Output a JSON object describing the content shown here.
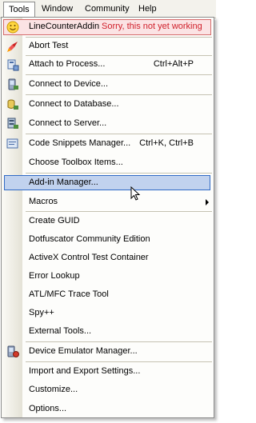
{
  "menubar": {
    "items": [
      "Tools",
      "Window",
      "Community",
      "Help"
    ]
  },
  "menu": {
    "error_item": {
      "label": "LineCounterAddin",
      "message": "Sorry, this not yet working",
      "icon": "smiley-icon"
    },
    "abort_test": {
      "label": "Abort Test",
      "icon": "rocket-icon"
    },
    "attach": {
      "label": "Attach to Process...",
      "shortcut": "Ctrl+Alt+P",
      "icon": "attach-process-icon"
    },
    "connect_device": {
      "label": "Connect to Device...",
      "icon": "device-icon"
    },
    "connect_db": {
      "label": "Connect to Database...",
      "icon": "database-icon"
    },
    "connect_server": {
      "label": "Connect to Server...",
      "icon": "server-icon"
    },
    "snippets": {
      "label": "Code Snippets Manager...",
      "shortcut": "Ctrl+K, Ctrl+B",
      "icon": "snippets-icon"
    },
    "toolbox": {
      "label": "Choose Toolbox Items..."
    },
    "addin": {
      "label": "Add-in Manager..."
    },
    "macros": {
      "label": "Macros"
    },
    "guid": {
      "label": "Create GUID"
    },
    "dotfuscator": {
      "label": "Dotfuscator Community Edition"
    },
    "activex": {
      "label": "ActiveX Control Test Container"
    },
    "error_lookup": {
      "label": "Error Lookup"
    },
    "trace": {
      "label": "ATL/MFC Trace Tool"
    },
    "spy": {
      "label": "Spy++"
    },
    "external": {
      "label": "External Tools..."
    },
    "emulator": {
      "label": "Device Emulator Manager...",
      "icon": "emulator-icon"
    },
    "import_export": {
      "label": "Import and Export Settings..."
    },
    "customize": {
      "label": "Customize..."
    },
    "options": {
      "label": "Options..."
    }
  },
  "colors": {
    "highlight": "#c1d2ee",
    "highlight_border": "#316ac5",
    "error_text": "#d0202b"
  }
}
